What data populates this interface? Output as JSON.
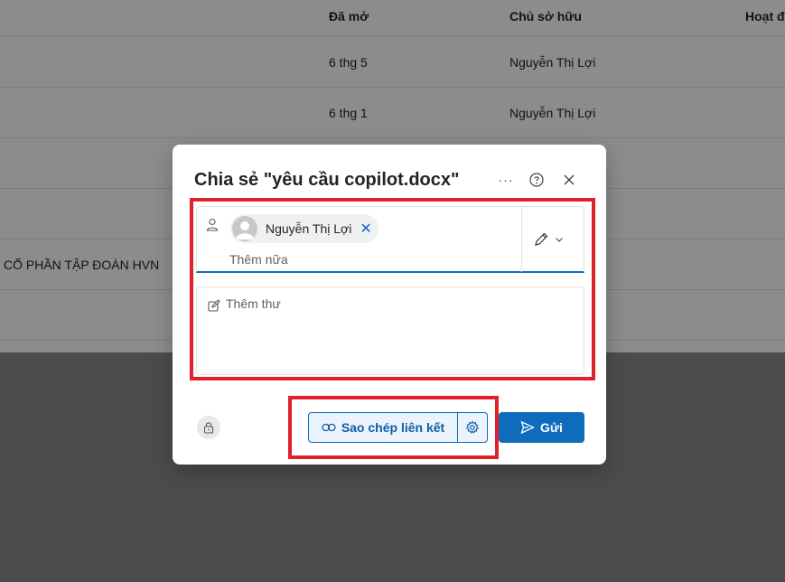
{
  "file_list": {
    "columns": {
      "opened": "Đã mở",
      "owner": "Chủ sở hữu",
      "activity": "Hoạt đ"
    },
    "rows": [
      {
        "name": "",
        "opened": "6 thg 5",
        "owner": "Nguyễn Thị Lợi"
      },
      {
        "name": "",
        "opened": "6 thg 1",
        "owner": "Nguyễn Thị Lợi"
      },
      {
        "name": "CỔ PHẦN TẬP ĐOÀN HVN",
        "opened": "",
        "owner": ""
      }
    ]
  },
  "dialog": {
    "title": "Chia sẻ \"yêu cầu copilot.docx\"",
    "more_label": "···",
    "help_label": "?",
    "close_label": "✕",
    "recipient": {
      "name": "Nguyễn Thị Lợi",
      "remove_label": "✕"
    },
    "add_more_placeholder": "Thêm nữa",
    "message_placeholder": "Thêm thư",
    "copy_link_label": "Sao chép liên kết",
    "send_label": "Gửi"
  },
  "colors": {
    "accent": "#0f6cbd",
    "annotation": "#e0202a"
  },
  "icons": {
    "person": "person-icon",
    "pencil": "pencil-icon",
    "chevron": "chevron-down-icon",
    "message": "note-edit-icon",
    "lock": "lock-icon",
    "link": "link-icon",
    "settings": "gear-icon",
    "send": "send-icon"
  }
}
